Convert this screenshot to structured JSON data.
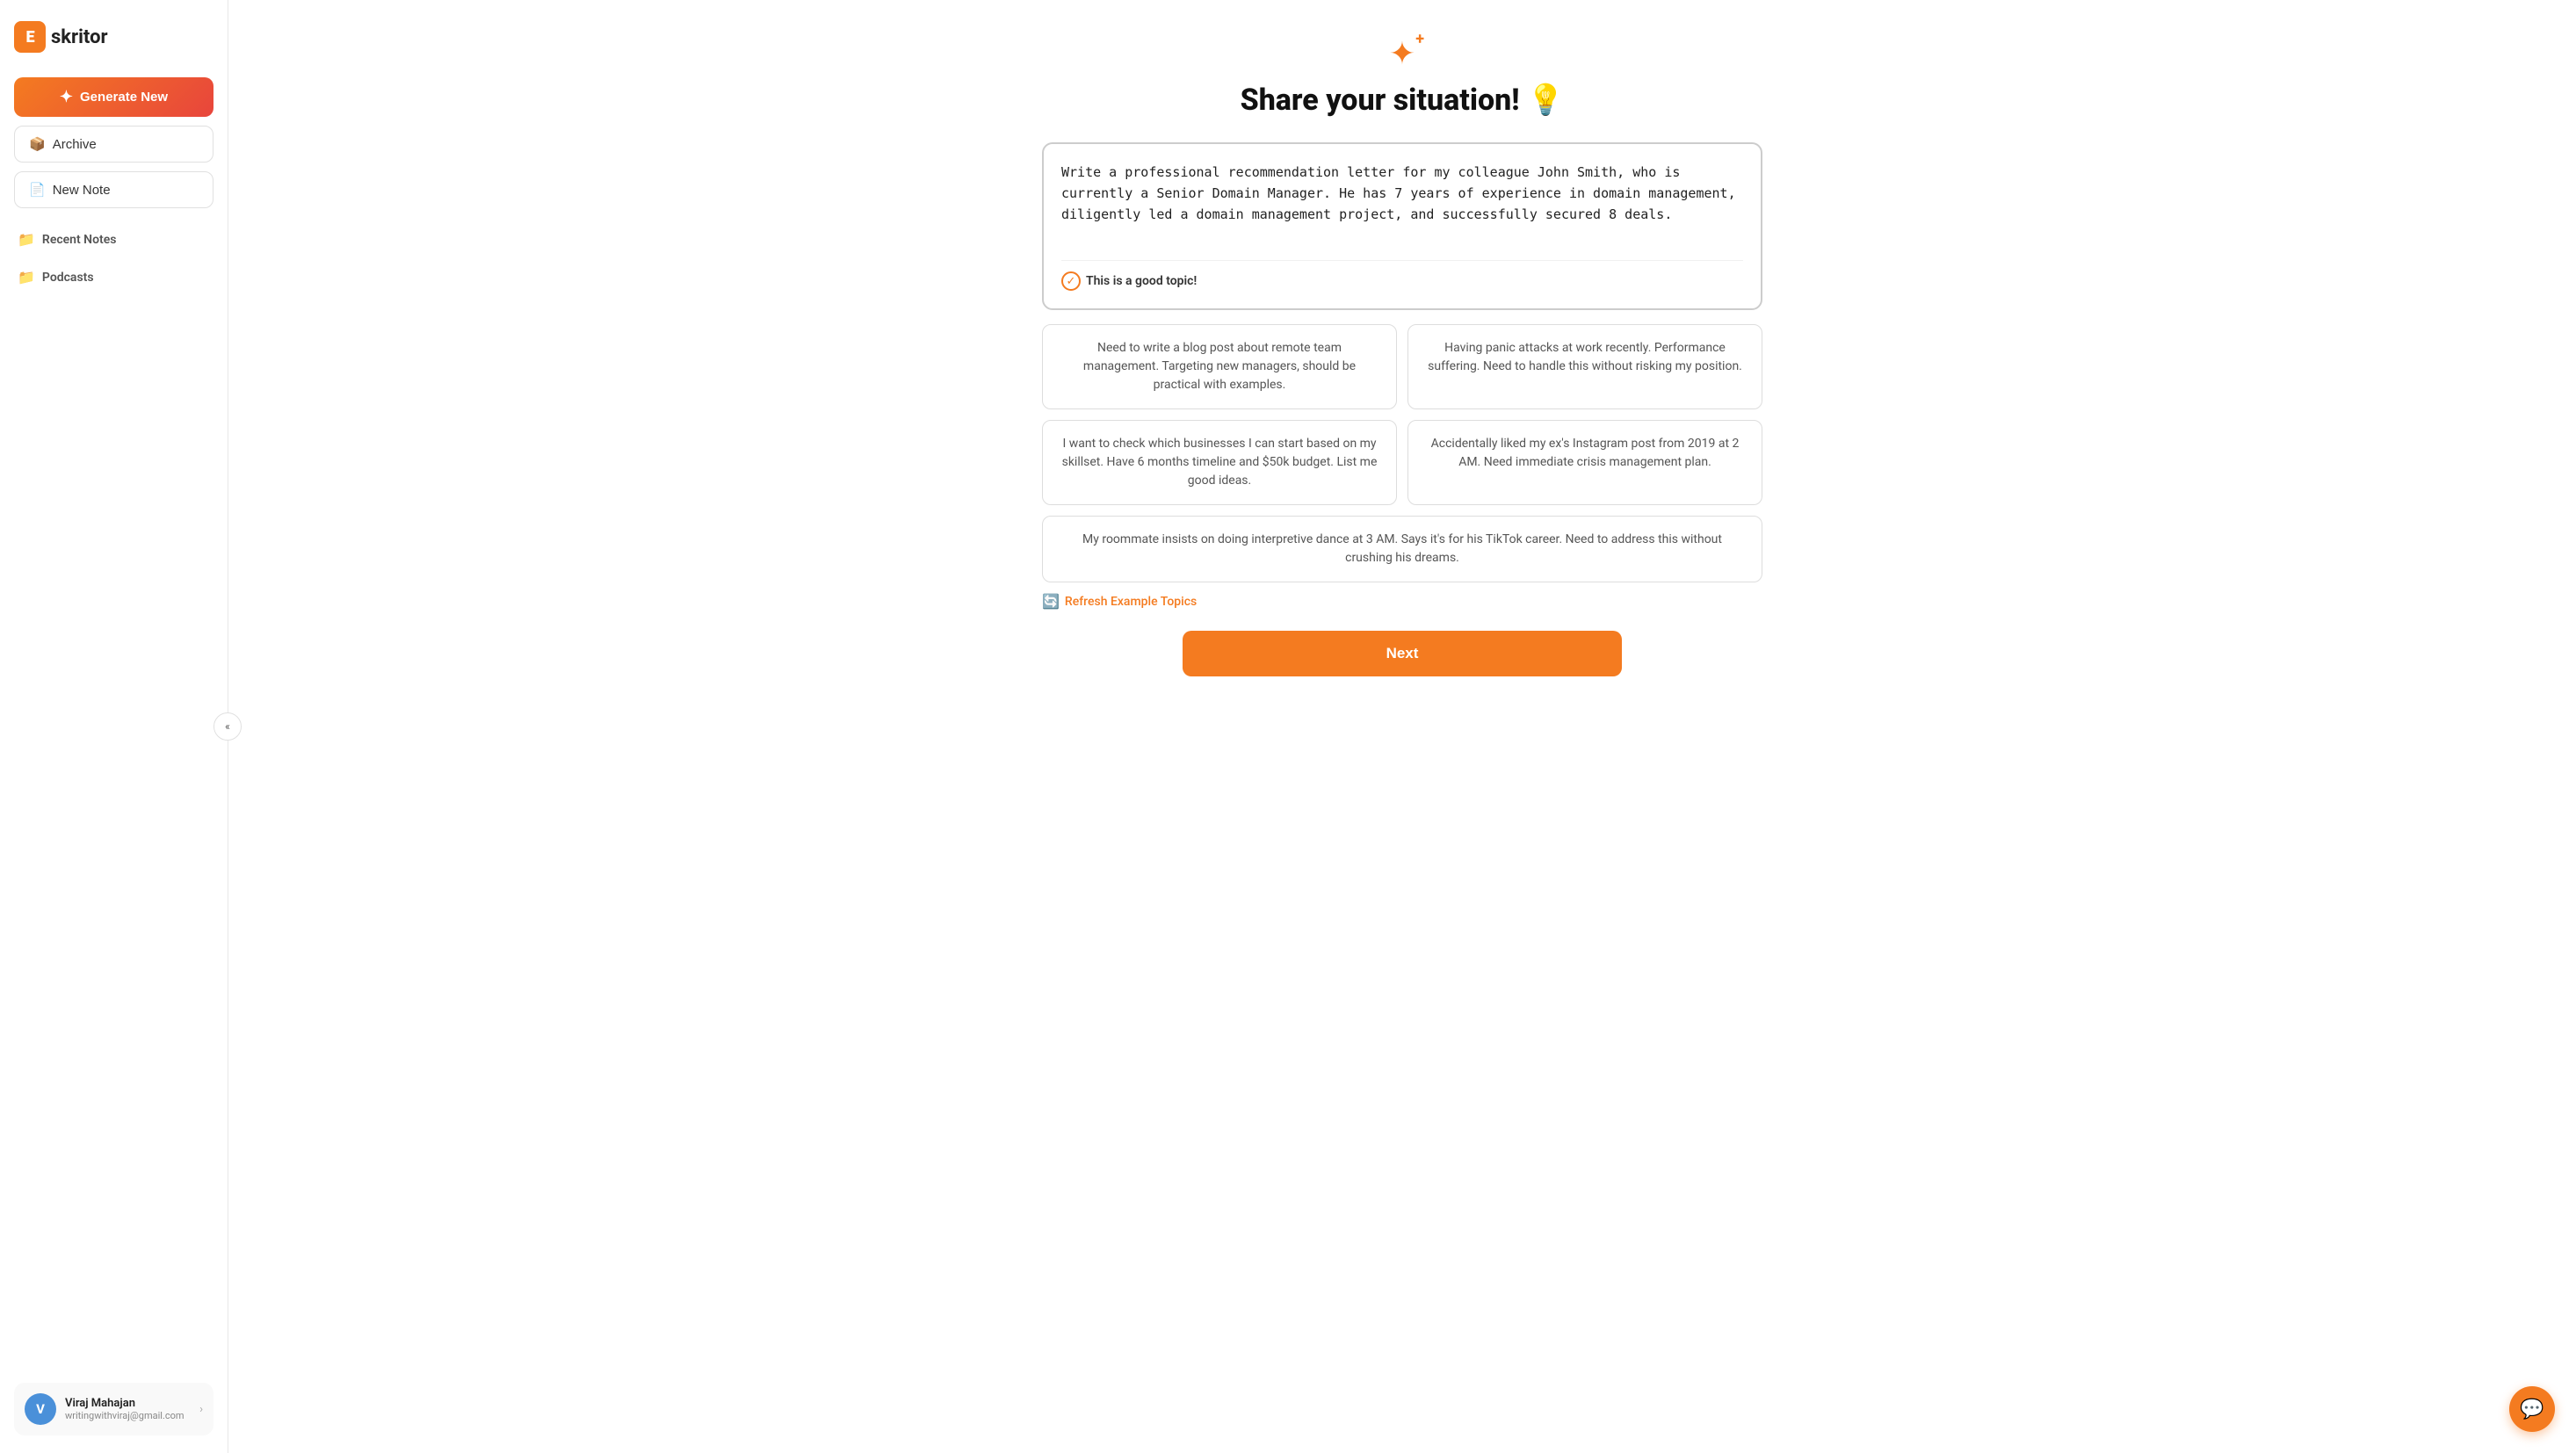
{
  "sidebar": {
    "logo_text_e": "E",
    "logo_text_rest": "skritor",
    "generate_btn_label": "Generate New",
    "archive_btn_label": "Archive",
    "new_note_btn_label": "New Note",
    "recent_notes_label": "Recent Notes",
    "podcasts_label": "Podcasts",
    "collapse_icon": "«"
  },
  "user": {
    "avatar_letter": "V",
    "name": "Viraj Mahajan",
    "email": "writingwithviraj@gmail.com",
    "chevron": "›"
  },
  "main": {
    "sparkle": "✦",
    "title": "Share your situation! 💡",
    "textarea_value": "Write a professional recommendation letter for my colleague John Smith, who is currently a Senior Domain Manager. He has 7 years of experience in domain management, diligently led a domain management project, and successfully secured 8 deals.",
    "good_topic_label": "This is a good topic!",
    "examples": [
      {
        "id": "ex1",
        "text": "Need to write a blog post about remote team management. Targeting new managers, should be practical with examples."
      },
      {
        "id": "ex2",
        "text": "Having panic attacks at work recently. Performance suffering. Need to handle this without risking my position."
      },
      {
        "id": "ex3",
        "text": "I want to check which businesses I can start based on my skillset. Have 6 months timeline and $50k budget. List me good ideas."
      },
      {
        "id": "ex4",
        "text": "Accidentally liked my ex's Instagram post from 2019 at 2 AM. Need immediate crisis management plan."
      },
      {
        "id": "ex5",
        "text": "My roommate insists on doing interpretive dance at 3 AM. Says it's for his TikTok career. Need to address this without crushing his dreams.",
        "full": true
      }
    ],
    "refresh_label": "Refresh Example Topics",
    "next_btn_label": "Next"
  },
  "support": {
    "icon": "⊙"
  }
}
